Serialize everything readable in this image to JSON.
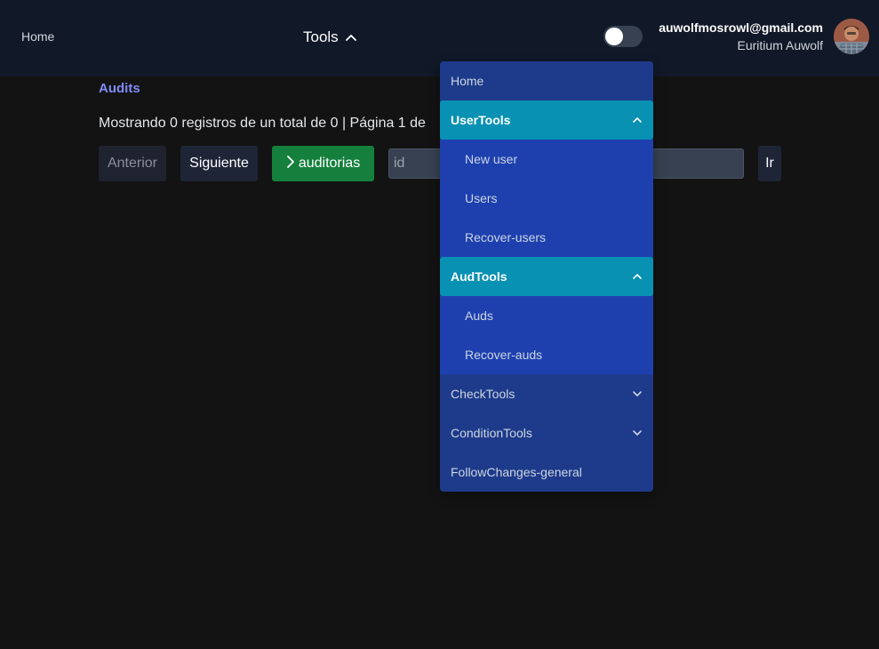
{
  "nav": {
    "home": "Home",
    "tools": "Tools"
  },
  "user": {
    "email": "auwolfmosrowl@gmail.com",
    "name": "Euritium Auwolf"
  },
  "theme_toggle": {
    "enabled": false
  },
  "main": {
    "title": "Audits",
    "summary": "Mostrando 0 registros de un total de 0 | Página 1 de",
    "buttons": {
      "prev": "Anterior",
      "next": "Siguiente",
      "audits": "auditorias",
      "go": "Ir"
    },
    "search": {
      "placeholder": "id",
      "value": ""
    }
  },
  "menu": {
    "home": "Home",
    "user_tools": {
      "label": "UserTools",
      "items": [
        "New user",
        "Users",
        "Recover-users"
      ]
    },
    "aud_tools": {
      "label": "AudTools",
      "items": [
        "Auds",
        "Recover-auds"
      ]
    },
    "check_tools": "CheckTools",
    "condition_tools": "ConditionTools",
    "follow_changes": "FollowChanges-general"
  },
  "colors": {
    "topbar": "#111827",
    "background": "#131313",
    "menu_bg": "#1e3a8a",
    "menu_section": "#0891b2",
    "menu_sub": "#1e40af",
    "accent_green": "#15803d",
    "title_accent": "#818cf8"
  },
  "icons": {
    "tools_toggle": "chevron-up-icon",
    "audits_button": "chevron-right-icon",
    "section_open": "chevron-up-icon",
    "section_closed": "chevron-down-icon"
  }
}
